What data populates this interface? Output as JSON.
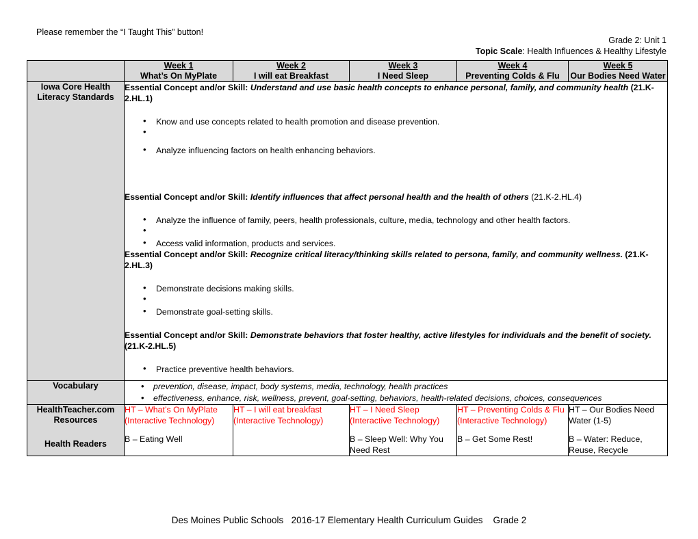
{
  "top_note": "Please remember the “I Taught This” button!",
  "header": {
    "grade_unit": "Grade 2: Unit 1",
    "topic_scale_label": "Topic Scale",
    "topic_scale_value": ": Health Influences & Healthy Lifestyle"
  },
  "colors": {
    "header_fill": "#d9d9d9",
    "resource_highlight": "#ff0000",
    "border": "#000000"
  },
  "table": {
    "columns": [
      {
        "week": "Week 1",
        "title": "What’s On MyPlate"
      },
      {
        "week": "Week 2",
        "title": "I will eat Breakfast"
      },
      {
        "week": "Week 3",
        "title": "I Need Sleep"
      },
      {
        "week": "Week 4",
        "title": "Preventing Colds & Flu"
      },
      {
        "week": "Week 5",
        "title": "Our Bodies Need Water"
      }
    ],
    "rows": {
      "standards": {
        "label": "Iowa Core Health Literacy Standards",
        "blocks": [
          {
            "ec_label": "Essential Concept and/or Skill:",
            "ec_text": " Understand and use basic health concepts to enhance personal, family, and community health",
            "ec_code": " (21.K-2.HL.1)",
            "bullets": [
              "Know and use concepts related to health promotion and disease prevention.",
              "Analyze influencing factors on health enhancing behaviors."
            ]
          },
          {
            "ec_label": "Essential Concept and/or Skill:",
            "ec_text": " Identify influences that affect personal health and the health of others",
            "ec_code": " (21.K-2.HL.4)",
            "bullets": [
              "Analyze the influence of family, peers, health professionals, culture, media, technology and other health factors.",
              "Access valid information, products and services."
            ]
          },
          {
            "ec_label": "Essential Concept and/or Skill:",
            "ec_text": " Recognize critical literacy/thinking skills related to persona, family, and community wellness.",
            "ec_code": " (21.K-2.HL.3)",
            "bullets": [
              "Demonstrate decisions making skills.",
              "Demonstrate goal-setting skills."
            ]
          },
          {
            "ec_label": "Essential Concept and/or Skill:",
            "ec_text": " Demonstrate behaviors that foster healthy, active lifestyles for individuals and the benefit of society.",
            "ec_code": " (21.K-2.HL.5)",
            "bullets": [
              "Practice preventive health behaviors."
            ]
          }
        ]
      },
      "vocabulary": {
        "label": "Vocabulary",
        "items": [
          "prevention, disease, impact, body systems, media, technology, health practices",
          "effectiveness, enhance, risk, wellness, prevent, goal-setting, behaviors, health-related decisions, choices, consequences"
        ]
      },
      "resources": {
        "label_1": "HealthTeacher.com Resources",
        "label_2": "Health Readers",
        "cells": [
          {
            "ht": "HT – What’s On MyPlate (Interactive Technology)",
            "book": "B – Eating Well"
          },
          {
            "ht": "HT – I will eat breakfast (Interactive Technology)",
            "book": ""
          },
          {
            "ht": "HT – I Need Sleep (Interactive Technology)",
            "book": "B – Sleep Well: Why You Need Rest"
          },
          {
            "ht": "HT – Preventing Colds & Flu (Interactive Technology)",
            "book": "B – Get Some Rest!"
          },
          {
            "ht": "HT – Our Bodies Need Water (1-5)",
            "book": "B – Water: Reduce, Reuse, Recycle"
          }
        ]
      }
    }
  },
  "footer": {
    "district": "Des Moines Public Schools",
    "guide": "2016-17 Elementary Health Curriculum Guides",
    "grade": "Grade 2"
  }
}
